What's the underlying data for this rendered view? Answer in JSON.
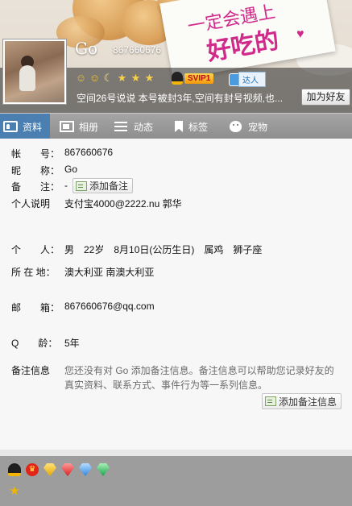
{
  "header": {
    "card_line1": "一定会遇上",
    "card_line2": "好吃的",
    "nickname": "Go",
    "qq_number": "867660676",
    "svip_label": "SVIP1",
    "daren_label": "达人",
    "status_text": "空间26号说说 本号被封3年,空间有封号视频,也...",
    "add_friend_label": "加为好友"
  },
  "tabs": [
    {
      "label": "资料",
      "icon": "profile-card-icon",
      "active": true
    },
    {
      "label": "相册",
      "icon": "photo-album-icon",
      "active": false
    },
    {
      "label": "动态",
      "icon": "feed-list-icon",
      "active": false
    },
    {
      "label": "标签",
      "icon": "bookmark-tag-icon",
      "active": false
    },
    {
      "label": "宠物",
      "icon": "pet-icon",
      "active": false
    }
  ],
  "profile": {
    "account_label": "帐　　号：",
    "account_value": "867660676",
    "nickname_label": "昵　　称：",
    "nickname_value": "Go",
    "remark_label": "备　　注：",
    "remark_value": "-",
    "add_remark_label": "添加备注",
    "bio_label": "个人说明",
    "bio_value": "支付宝4000@2222.nu  郭华",
    "personal_label": "个　　人：",
    "personal_value": "男　22岁　8月10日(公历生日)　属鸡　狮子座",
    "location_label": "所 在 地：",
    "location_value": "澳大利亚 南澳大利亚",
    "email_label": "邮　　箱：",
    "email_value": "867660676@qq.com",
    "qage_label": "Q　　龄：",
    "qage_value": "5年",
    "remark_info_label": "备注信息",
    "remark_info_desc": "您还没有对 Go 添加备注信息。备注信息可以帮助您记录好友的真实资料、联系方式、事件行为等一系列信息。",
    "add_remark_info_label": "添加备注信息"
  },
  "colors": {
    "tab_active": "#4b7fb2",
    "tab_bar": "#9a9a9a",
    "card_text": "#d02a8a"
  }
}
